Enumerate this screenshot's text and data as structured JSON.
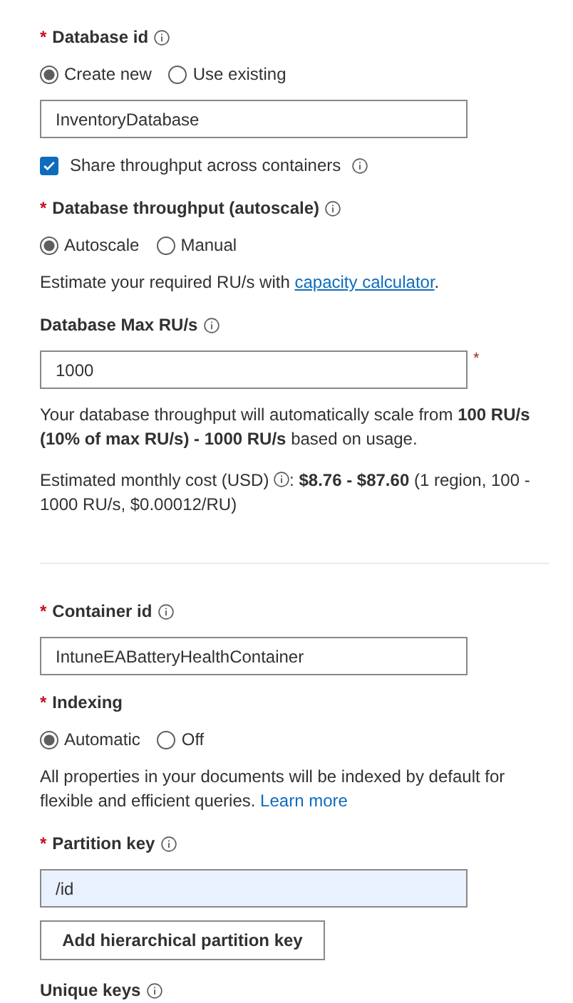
{
  "form": [
    {
      "kind": "label",
      "asterisk": "*",
      "text": "Database id",
      "info": true
    },
    {
      "kind": "radios",
      "options": [
        {
          "label": "Create new",
          "selected": true
        },
        {
          "label": "Use existing",
          "selected": false
        }
      ]
    },
    {
      "kind": "input",
      "value": "InventoryDatabase",
      "highlighted": false
    },
    {
      "kind": "checkbox",
      "label": "Share throughput across containers",
      "checked": true,
      "info": true
    },
    {
      "kind": "label",
      "asterisk": "*",
      "text": "Database throughput (autoscale)",
      "info": true
    },
    {
      "kind": "radios",
      "options": [
        {
          "label": "Autoscale",
          "selected": true
        },
        {
          "label": "Manual",
          "selected": false
        }
      ]
    },
    {
      "kind": "paragraph",
      "parts": [
        {
          "kind": "text",
          "text": "Estimate your required RU/s with "
        },
        {
          "kind": "link",
          "text": "capacity calculator"
        },
        {
          "kind": "text",
          "text": "."
        }
      ]
    },
    {
      "kind": "label",
      "text": "Database Max RU/s",
      "info": true
    },
    {
      "kind": "input",
      "value": "1000",
      "asterisk": "*",
      "highlighted": false
    },
    {
      "kind": "paragraph",
      "parts": [
        {
          "kind": "text",
          "text": "Your database throughput will automatically scale from **100 RU/s (10% of max RU/s) - 1000 RU/s** based on usage."
        }
      ]
    },
    {
      "kind": "paragraph",
      "parts": [
        {
          "kind": "text",
          "text": "Estimated monthly cost (USD) "
        },
        {
          "kind": "info"
        },
        {
          "kind": "text",
          "text": ": **$8.76 - $87.60** (1 region, 100 - 1000 RU/s, $0.00012/RU)"
        }
      ]
    },
    {
      "kind": "divider"
    },
    {
      "kind": "label",
      "asterisk": "*",
      "text": "Container id",
      "info": true
    },
    {
      "kind": "input",
      "value": "IntuneEABatteryHealthContainer",
      "highlighted": false
    },
    {
      "kind": "label",
      "asterisk": "*",
      "text": "Indexing"
    },
    {
      "kind": "radios",
      "options": [
        {
          "label": "Automatic",
          "selected": true
        },
        {
          "label": "Off",
          "selected": false
        }
      ]
    },
    {
      "kind": "paragraph",
      "parts": [
        {
          "kind": "text",
          "text": "All properties in your documents will be indexed by default for flexible and efficient queries. "
        },
        {
          "kind": "link",
          "text": "Learn more"
        }
      ]
    },
    {
      "kind": "label",
      "asterisk": "*",
      "text": "Partition key",
      "info": true
    },
    {
      "kind": "input",
      "value": "/id",
      "highlighted": true
    },
    {
      "kind": "button",
      "text": "Add hierarchical partition key"
    },
    {
      "kind": "label",
      "text": "Unique keys",
      "info": true
    }
  ]
}
